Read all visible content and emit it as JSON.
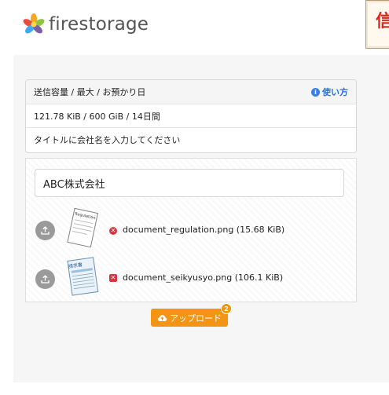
{
  "header": {
    "logo_text": "firestorage",
    "corner_glyph": "信"
  },
  "info": {
    "heading": "送信容量 / 最大 / お預かり日",
    "help_label": "使い方",
    "capacity": "121.78 KiB / 600 GiB / 14日間",
    "hint": "タイトルに会社名を入力してください"
  },
  "form": {
    "title_value": "ABC株式会社"
  },
  "files": [
    {
      "name": "document_regulation.png (15.68 KiB)",
      "thumb_text": "Regulation",
      "remove_icon": "x-circle-icon"
    },
    {
      "name": "document_seikyusyo.png (106.1 KiB)",
      "thumb_text": "請求書",
      "remove_icon": "x-square-icon"
    }
  ],
  "upload_button": {
    "label": "アップロード",
    "count": "2"
  },
  "colors": {
    "accent": "#f39414",
    "danger": "#d9343f",
    "link": "#2a6fd6"
  }
}
